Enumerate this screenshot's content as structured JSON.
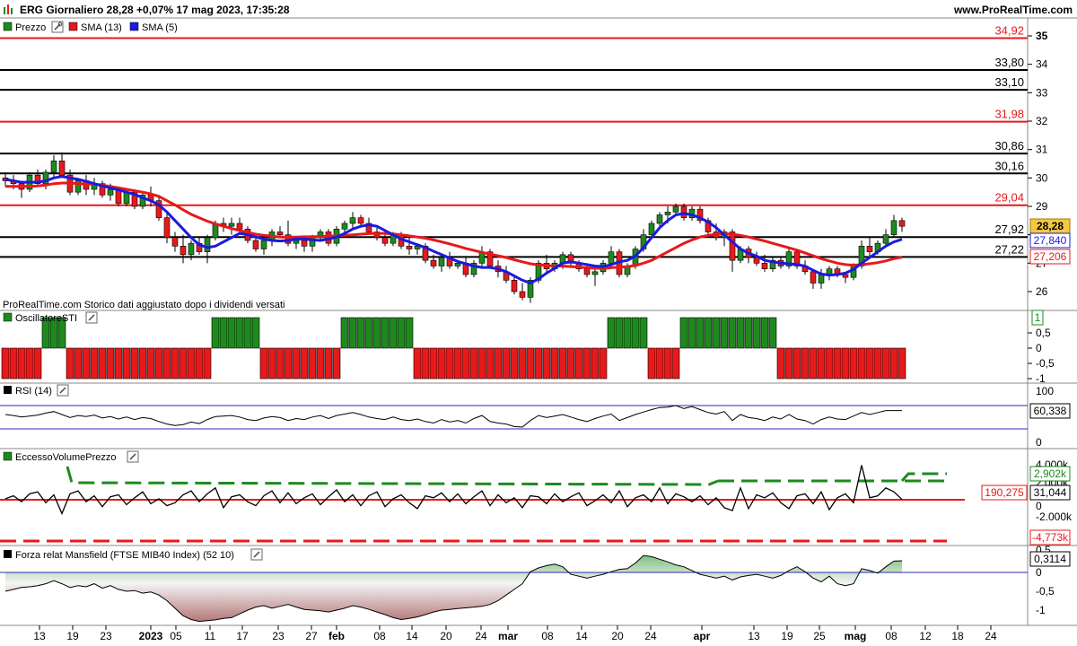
{
  "header": {
    "title": "ERG Giornaliero 28,28 +0,07% 17 mag 2023, 17:35:28",
    "site": "www.ProRealTime.com"
  },
  "colors": {
    "up": "#1e8a1e",
    "down": "#e8191b",
    "sma13": "#e8191b",
    "sma5": "#1a1adf",
    "osc_green": "#1e8a1e",
    "osc_red": "#e8191b",
    "mansfield_fill": "#b47878",
    "mansfield_fill_pos": "#7fbf7f"
  },
  "legends": {
    "price": [
      "Prezzo",
      "SMA (13)",
      "SMA (5)"
    ],
    "osc": "OscillatoreSTI",
    "rsi": "RSI (14)",
    "evp": "EccessoVolumePrezzo",
    "mansfield": "Forza relat Mansfield (FTSE MIB40 Index) (52 10)"
  },
  "note": "ProRealTime.com Storico dati aggiustato dopo i dividendi versati",
  "levels": [
    {
      "label": "34,92",
      "value": 34.92,
      "color": "#e8191b"
    },
    {
      "label": "33,80",
      "value": 33.8,
      "color": "#000000"
    },
    {
      "label": "33,10",
      "value": 33.1,
      "color": "#000000"
    },
    {
      "label": "31,98",
      "value": 31.98,
      "color": "#e8191b"
    },
    {
      "label": "30,86",
      "value": 30.86,
      "color": "#000000"
    },
    {
      "label": "30,16",
      "value": 30.16,
      "color": "#000000"
    },
    {
      "label": "29,04",
      "value": 29.04,
      "color": "#e8191b"
    },
    {
      "label": "27,92",
      "value": 27.92,
      "color": "#000000"
    },
    {
      "label": "27,22",
      "value": 27.22,
      "color": "#000000"
    }
  ],
  "price_axis": {
    "ticks": [
      "35",
      "34",
      "33",
      "32",
      "31",
      "30",
      "29",
      "28",
      "27",
      "26"
    ],
    "min": 25.4,
    "max": 35.2
  },
  "badges": {
    "last": "28,28",
    "sma5": "27,840",
    "sma13": "27,206",
    "osc": "1",
    "rsi": "60,338",
    "evp_level": "190,275",
    "evp_val": "31,044",
    "evp_up": "2,902k",
    "evp_down": "-4,773k",
    "mansfield": "0,3114"
  },
  "osc_axis": [
    "1",
    "0,5",
    "0",
    "-0,5",
    "-1"
  ],
  "rsi_axis": [
    "100",
    "0"
  ],
  "evp_axis": [
    "4.000k",
    "2.000k",
    "0",
    "-2.000k"
  ],
  "mansfield_axis": [
    "0,5",
    "0",
    "-0,5",
    "-1"
  ],
  "x_axis": {
    "labels": [
      "13",
      "19",
      "23",
      "2023",
      "05",
      "11",
      "17",
      "23",
      "27",
      "feb",
      "08",
      "14",
      "20",
      "24",
      "mar",
      "08",
      "14",
      "20",
      "24",
      "apr",
      "13",
      "19",
      "25",
      "mag",
      "08",
      "12",
      "18",
      "24"
    ],
    "bold": [
      "2023",
      "feb",
      "mar",
      "apr",
      "mag"
    ]
  },
  "chart_data": {
    "type": "candlestick",
    "title": "ERG Giornaliero",
    "candles": [
      [
        30.0,
        30.2,
        29.7,
        29.9
      ],
      [
        29.9,
        30.1,
        29.6,
        29.8
      ],
      [
        29.8,
        29.9,
        29.3,
        29.6
      ],
      [
        29.6,
        30.2,
        29.5,
        30.1
      ],
      [
        30.1,
        30.3,
        29.7,
        29.8
      ],
      [
        29.8,
        30.3,
        29.6,
        30.2
      ],
      [
        30.2,
        30.8,
        30.0,
        30.6
      ],
      [
        30.6,
        30.9,
        30.0,
        30.1
      ],
      [
        30.1,
        30.3,
        29.4,
        29.5
      ],
      [
        29.5,
        30.0,
        29.4,
        29.9
      ],
      [
        29.9,
        30.1,
        29.4,
        29.6
      ],
      [
        29.6,
        30.0,
        29.4,
        29.8
      ],
      [
        29.8,
        29.9,
        29.3,
        29.4
      ],
      [
        29.4,
        29.8,
        29.2,
        29.6
      ],
      [
        29.6,
        29.7,
        29.0,
        29.1
      ],
      [
        29.1,
        29.6,
        29.0,
        29.5
      ],
      [
        29.5,
        29.6,
        28.9,
        29.0
      ],
      [
        29.0,
        29.5,
        28.9,
        29.4
      ],
      [
        29.4,
        29.7,
        29.0,
        29.2
      ],
      [
        29.2,
        29.4,
        28.5,
        28.6
      ],
      [
        28.6,
        28.8,
        27.7,
        27.9
      ],
      [
        27.9,
        28.1,
        27.4,
        27.6
      ],
      [
        27.6,
        28.0,
        27.0,
        27.3
      ],
      [
        27.3,
        27.8,
        27.1,
        27.7
      ],
      [
        27.7,
        27.9,
        27.3,
        27.4
      ],
      [
        27.4,
        28.0,
        27.0,
        27.9
      ],
      [
        27.9,
        28.5,
        27.8,
        28.4
      ],
      [
        28.4,
        28.6,
        28.1,
        28.3
      ],
      [
        28.3,
        28.6,
        28.0,
        28.4
      ],
      [
        28.4,
        28.6,
        28.1,
        28.2
      ],
      [
        28.2,
        28.3,
        27.7,
        27.8
      ],
      [
        27.8,
        28.0,
        27.4,
        27.5
      ],
      [
        27.5,
        27.9,
        27.3,
        27.8
      ],
      [
        27.8,
        28.2,
        27.6,
        28.1
      ],
      [
        28.1,
        28.3,
        27.9,
        28.0
      ],
      [
        28.0,
        28.5,
        27.6,
        27.7
      ],
      [
        27.7,
        27.9,
        27.5,
        27.8
      ],
      [
        27.8,
        27.9,
        27.4,
        27.6
      ],
      [
        27.6,
        28.0,
        27.4,
        27.9
      ],
      [
        27.9,
        28.2,
        27.8,
        28.1
      ],
      [
        28.1,
        28.2,
        27.6,
        27.7
      ],
      [
        27.7,
        28.3,
        27.6,
        28.2
      ],
      [
        28.2,
        28.5,
        28.0,
        28.4
      ],
      [
        28.4,
        28.8,
        28.2,
        28.6
      ],
      [
        28.6,
        28.7,
        28.3,
        28.4
      ],
      [
        28.4,
        28.6,
        28.0,
        28.1
      ],
      [
        28.1,
        28.3,
        27.8,
        27.9
      ],
      [
        27.9,
        28.2,
        27.6,
        27.7
      ],
      [
        27.7,
        28.1,
        27.6,
        28.0
      ],
      [
        28.0,
        28.1,
        27.5,
        27.6
      ],
      [
        27.6,
        27.9,
        27.3,
        27.5
      ],
      [
        27.5,
        27.7,
        27.3,
        27.6
      ],
      [
        27.6,
        27.7,
        27.0,
        27.1
      ],
      [
        27.1,
        27.3,
        26.8,
        26.9
      ],
      [
        26.9,
        27.3,
        26.7,
        27.2
      ],
      [
        27.2,
        27.4,
        26.8,
        26.9
      ],
      [
        26.9,
        27.1,
        26.8,
        27.0
      ],
      [
        27.0,
        27.2,
        26.5,
        26.6
      ],
      [
        26.6,
        27.1,
        26.5,
        27.0
      ],
      [
        27.0,
        27.6,
        26.9,
        27.4
      ],
      [
        27.4,
        27.5,
        26.8,
        26.9
      ],
      [
        26.9,
        27.1,
        26.5,
        26.7
      ],
      [
        26.7,
        26.9,
        26.3,
        26.4
      ],
      [
        26.4,
        26.6,
        25.9,
        26.0
      ],
      [
        26.0,
        26.3,
        25.7,
        25.8
      ],
      [
        25.8,
        26.5,
        25.6,
        26.4
      ],
      [
        26.4,
        27.1,
        26.3,
        27.0
      ],
      [
        27.0,
        27.3,
        26.7,
        26.8
      ],
      [
        26.8,
        27.1,
        26.7,
        27.0
      ],
      [
        27.0,
        27.4,
        26.8,
        27.3
      ],
      [
        27.3,
        27.4,
        26.9,
        27.0
      ],
      [
        27.0,
        27.1,
        26.7,
        26.8
      ],
      [
        26.8,
        27.0,
        26.5,
        26.6
      ],
      [
        26.6,
        26.9,
        26.2,
        26.7
      ],
      [
        26.7,
        27.1,
        26.6,
        27.0
      ],
      [
        27.0,
        27.6,
        26.8,
        27.4
      ],
      [
        27.4,
        27.5,
        26.5,
        26.6
      ],
      [
        26.6,
        27.0,
        26.5,
        26.9
      ],
      [
        26.9,
        27.6,
        26.8,
        27.5
      ],
      [
        27.5,
        28.2,
        27.4,
        28.0
      ],
      [
        28.0,
        28.5,
        27.9,
        28.4
      ],
      [
        28.4,
        28.8,
        28.2,
        28.7
      ],
      [
        28.7,
        29.0,
        28.4,
        28.8
      ],
      [
        28.8,
        29.1,
        28.7,
        29.0
      ],
      [
        29.0,
        29.1,
        28.5,
        28.6
      ],
      [
        28.6,
        29.0,
        28.5,
        28.9
      ],
      [
        28.9,
        29.0,
        28.4,
        28.5
      ],
      [
        28.5,
        28.6,
        28.0,
        28.1
      ],
      [
        28.1,
        28.4,
        27.8,
        27.9
      ],
      [
        27.9,
        28.2,
        27.6,
        28.1
      ],
      [
        28.1,
        28.2,
        26.7,
        27.1
      ],
      [
        27.1,
        27.6,
        27.0,
        27.5
      ],
      [
        27.5,
        27.6,
        27.0,
        27.2
      ],
      [
        27.2,
        27.4,
        26.9,
        27.0
      ],
      [
        27.0,
        27.3,
        26.7,
        26.8
      ],
      [
        26.8,
        27.2,
        26.7,
        27.1
      ],
      [
        27.1,
        27.2,
        26.8,
        26.9
      ],
      [
        26.9,
        27.5,
        26.8,
        27.4
      ],
      [
        27.4,
        27.5,
        26.8,
        26.9
      ],
      [
        26.9,
        27.1,
        26.6,
        26.7
      ],
      [
        26.7,
        26.8,
        26.1,
        26.3
      ],
      [
        26.3,
        26.8,
        26.1,
        26.6
      ],
      [
        26.6,
        26.9,
        26.4,
        26.8
      ],
      [
        26.8,
        26.9,
        26.5,
        26.6
      ],
      [
        26.6,
        26.7,
        26.3,
        26.5
      ],
      [
        26.5,
        27.0,
        26.4,
        26.9
      ],
      [
        26.9,
        27.8,
        26.8,
        27.6
      ],
      [
        27.6,
        27.9,
        27.2,
        27.4
      ],
      [
        27.4,
        27.8,
        27.3,
        27.7
      ],
      [
        27.7,
        28.2,
        27.6,
        28.0
      ],
      [
        28.0,
        28.7,
        27.9,
        28.5
      ],
      [
        28.5,
        28.6,
        28.1,
        28.3
      ]
    ],
    "sma13": [
      29.7,
      29.7,
      29.7,
      29.7,
      29.72,
      29.75,
      29.8,
      29.82,
      29.82,
      29.8,
      29.79,
      29.78,
      29.75,
      29.7,
      29.65,
      29.6,
      29.55,
      29.5,
      29.44,
      29.35,
      29.2,
      29.05,
      28.88,
      28.72,
      28.6,
      28.48,
      28.38,
      28.3,
      28.22,
      28.15,
      28.08,
      28.02,
      27.98,
      27.95,
      27.92,
      27.92,
      27.92,
      27.93,
      27.93,
      27.94,
      27.95,
      27.96,
      27.98,
      28.0,
      28.02,
      28.04,
      28.05,
      28.05,
      28.03,
      28.0,
      27.96,
      27.92,
      27.88,
      27.82,
      27.75,
      27.68,
      27.6,
      27.52,
      27.45,
      27.38,
      27.32,
      27.26,
      27.2,
      27.12,
      27.05,
      26.98,
      26.94,
      26.92,
      26.9,
      26.9,
      26.88,
      26.86,
      26.84,
      26.82,
      26.82,
      26.84,
      26.86,
      26.88,
      26.92,
      27.0,
      27.1,
      27.25,
      27.4,
      27.55,
      27.7,
      27.82,
      27.92,
      27.98,
      28.02,
      28.03,
      28.02,
      27.98,
      27.92,
      27.85,
      27.78,
      27.7,
      27.62,
      27.54,
      27.46,
      27.36,
      27.26,
      27.16,
      27.08,
      27.0,
      26.95,
      26.93,
      26.95,
      26.98,
      27.02,
      27.08,
      27.16,
      27.21
    ],
    "sma5": [
      29.95,
      29.9,
      29.85,
      29.85,
      29.85,
      29.9,
      30.0,
      30.05,
      30.0,
      29.95,
      29.88,
      29.8,
      29.72,
      29.65,
      29.58,
      29.5,
      29.42,
      29.3,
      29.2,
      29.05,
      28.8,
      28.5,
      28.2,
      27.9,
      27.65,
      27.55,
      27.6,
      27.75,
      27.9,
      28.05,
      28.0,
      27.92,
      27.85,
      27.8,
      27.78,
      27.8,
      27.85,
      27.85,
      27.82,
      27.8,
      27.85,
      27.92,
      28.05,
      28.2,
      28.3,
      28.35,
      28.3,
      28.15,
      28.0,
      27.85,
      27.75,
      27.65,
      27.55,
      27.42,
      27.3,
      27.18,
      27.06,
      26.98,
      26.9,
      26.85,
      26.85,
      26.8,
      26.7,
      26.55,
      26.4,
      26.3,
      26.45,
      26.65,
      26.82,
      27.0,
      27.05,
      27.0,
      26.95,
      26.9,
      26.88,
      26.95,
      27.05,
      27.1,
      27.25,
      27.55,
      27.9,
      28.25,
      28.5,
      28.7,
      28.75,
      28.7,
      28.6,
      28.45,
      28.25,
      28.0,
      27.75,
      27.5,
      27.35,
      27.25,
      27.1,
      27.05,
      27.0,
      26.98,
      26.95,
      26.9,
      26.75,
      26.62,
      26.58,
      26.6,
      26.65,
      26.78,
      27.0,
      27.2,
      27.4,
      27.6,
      27.75,
      27.84
    ],
    "osc": [
      -1,
      -1,
      -1,
      -1,
      -1,
      1,
      1,
      1,
      -1,
      -1,
      -1,
      -1,
      -1,
      -1,
      -1,
      -1,
      -1,
      -1,
      -1,
      -1,
      -1,
      -1,
      -1,
      -1,
      -1,
      -1,
      1,
      1,
      1,
      1,
      1,
      1,
      -1,
      -1,
      -1,
      -1,
      -1,
      -1,
      -1,
      -1,
      -1,
      -1,
      1,
      1,
      1,
      1,
      1,
      1,
      1,
      1,
      1,
      -1,
      -1,
      -1,
      -1,
      -1,
      -1,
      -1,
      -1,
      -1,
      -1,
      -1,
      -1,
      -1,
      -1,
      -1,
      -1,
      -1,
      -1,
      -1,
      -1,
      -1,
      -1,
      -1,
      -1,
      1,
      1,
      1,
      1,
      1,
      -1,
      -1,
      -1,
      -1,
      1,
      1,
      1,
      1,
      1,
      1,
      1,
      1,
      1,
      1,
      1,
      1,
      -1,
      -1,
      -1,
      -1,
      -1,
      -1,
      -1,
      -1,
      -1,
      -1,
      -1,
      -1,
      -1,
      -1,
      -1,
      -1,
      -1,
      -1,
      -1,
      -1,
      -1,
      1,
      1,
      1,
      1,
      1,
      1,
      1,
      1,
      1
    ],
    "rsi": [
      52,
      50,
      47,
      49,
      51,
      55,
      58,
      52,
      46,
      50,
      48,
      51,
      45,
      48,
      43,
      47,
      42,
      46,
      44,
      38,
      33,
      30,
      32,
      37,
      34,
      42,
      48,
      49,
      50,
      47,
      42,
      40,
      45,
      48,
      46,
      40,
      44,
      42,
      47,
      50,
      44,
      50,
      53,
      56,
      52,
      47,
      44,
      42,
      47,
      42,
      40,
      43,
      38,
      35,
      42,
      37,
      40,
      35,
      44,
      50,
      38,
      35,
      33,
      28,
      27,
      40,
      50,
      46,
      49,
      52,
      47,
      42,
      38,
      44,
      49,
      53,
      40,
      46,
      52,
      57,
      62,
      66,
      67,
      70,
      64,
      68,
      62,
      56,
      53,
      58,
      40,
      52,
      46,
      44,
      40,
      47,
      43,
      52,
      43,
      40,
      33,
      42,
      47,
      43,
      42,
      49,
      56,
      52,
      56,
      60,
      60,
      60
    ],
    "evp": [
      100,
      400,
      -200,
      600,
      800,
      -300,
      500,
      -1400,
      600,
      900,
      -200,
      400,
      -700,
      300,
      500,
      -500,
      200,
      800,
      -400,
      100,
      -600,
      -300,
      500,
      900,
      -200,
      600,
      1200,
      -800,
      300,
      500,
      -200,
      -600,
      400,
      900,
      -300,
      700,
      -400,
      200,
      600,
      -500,
      300,
      1000,
      -200,
      500,
      -600,
      400,
      800,
      -700,
      100,
      500,
      -300,
      -900,
      400,
      200,
      700,
      -200,
      600,
      -400,
      300,
      900,
      -600,
      500,
      -300,
      200,
      -800,
      400,
      300,
      -400,
      600,
      -200,
      300,
      700,
      -600,
      -100,
      500,
      -300,
      900,
      -700,
      200,
      500,
      -200,
      1200,
      -400,
      600,
      300,
      -200,
      400,
      -500,
      200,
      -800,
      -1100,
      1200,
      -900,
      500,
      200,
      700,
      -300,
      -900,
      400,
      600,
      -400,
      800,
      -1000,
      200,
      600,
      -300,
      3500,
      200,
      400,
      1200,
      800,
      31
    ],
    "mansfield": [
      -0.5,
      -0.45,
      -0.4,
      -0.38,
      -0.35,
      -0.3,
      -0.22,
      -0.3,
      -0.4,
      -0.35,
      -0.38,
      -0.3,
      -0.42,
      -0.35,
      -0.45,
      -0.5,
      -0.48,
      -0.55,
      -0.52,
      -0.6,
      -0.75,
      -0.95,
      -1.15,
      -1.25,
      -1.3,
      -1.28,
      -1.26,
      -1.22,
      -1.2,
      -1.1,
      -1.0,
      -0.92,
      -0.88,
      -0.95,
      -0.9,
      -0.85,
      -0.92,
      -0.98,
      -1.0,
      -1.02,
      -1.05,
      -1.0,
      -0.95,
      -0.88,
      -0.92,
      -0.98,
      -1.05,
      -1.12,
      -1.2,
      -1.25,
      -1.22,
      -1.18,
      -1.12,
      -1.05,
      -1.0,
      -0.98,
      -0.96,
      -0.94,
      -0.92,
      -0.9,
      -0.85,
      -0.75,
      -0.6,
      -0.45,
      -0.3,
      0.02,
      0.12,
      0.18,
      0.22,
      0.15,
      -0.05,
      -0.1,
      -0.15,
      -0.1,
      -0.05,
      0.02,
      0.08,
      0.1,
      0.25,
      0.45,
      0.42,
      0.35,
      0.28,
      0.2,
      0.15,
      0.05,
      -0.05,
      -0.1,
      -0.15,
      -0.1,
      -0.2,
      -0.12,
      -0.08,
      -0.05,
      -0.1,
      -0.15,
      -0.08,
      0.05,
      0.15,
      0.02,
      -0.15,
      -0.25,
      -0.1,
      -0.3,
      -0.35,
      -0.3,
      0.1,
      0.05,
      -0.02,
      0.15,
      0.3,
      0.31
    ],
    "evp_upper_line": 2902,
    "evp_lower_line": -4773,
    "evp_zero_level": 190.275,
    "price_range": [
      25.4,
      35.2
    ]
  }
}
